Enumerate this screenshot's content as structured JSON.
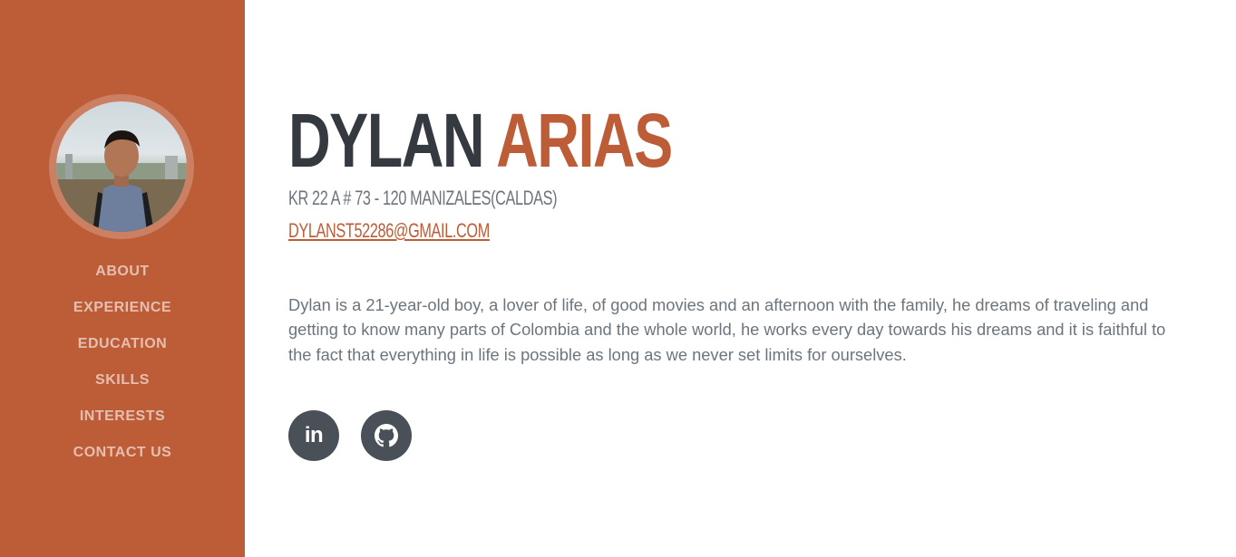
{
  "profile": {
    "first_name": "DYLAN",
    "last_name": "ARIAS",
    "address": "KR 22 A # 73 - 120 MANIZALES(CALDAS)",
    "email": "DYLANST52286@GMAIL.COM",
    "bio": "Dylan is a 21-year-old boy, a lover of life, of good movies and an afternoon with the family, he dreams of traveling and getting to know many parts of Colombia and the whole world, he works every day towards his dreams and it is faithful to the fact that everything in life is possible as long as we never set limits for ourselves."
  },
  "nav": {
    "items": [
      {
        "label": "ABOUT"
      },
      {
        "label": "EXPERIENCE"
      },
      {
        "label": "EDUCATION"
      },
      {
        "label": "SKILLS"
      },
      {
        "label": "INTERESTS"
      },
      {
        "label": "CONTACT US"
      }
    ]
  },
  "social": {
    "linkedin_label": "in",
    "linkedin_icon": "linkedin-icon",
    "github_icon": "github-icon"
  },
  "colors": {
    "accent": "#bd5d38",
    "heading": "#343a40",
    "muted": "#6c757d",
    "social_bg": "#495057"
  }
}
